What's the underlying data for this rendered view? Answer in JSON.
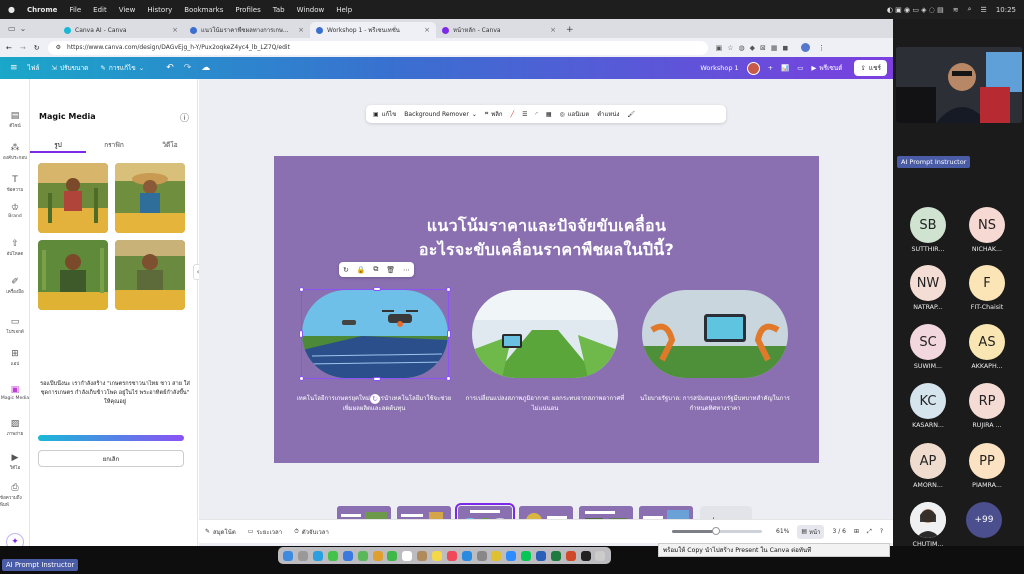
{
  "menubar": {
    "app": "Chrome",
    "items": [
      "File",
      "Edit",
      "View",
      "History",
      "Bookmarks",
      "Profiles",
      "Tab",
      "Window",
      "Help"
    ],
    "clock": "10:25"
  },
  "tabs": [
    {
      "label": "Canva AI - Canva"
    },
    {
      "label": "แนวโน้มราคาพืชผลทางการเกษ..."
    },
    {
      "label": "Workshop 1 - พรีเซนเทชั่น"
    },
    {
      "label": "หน้าหลัก - Canva"
    }
  ],
  "address": {
    "url": "https://www.canva.com/design/DAGvEjg_h-Y/Pux2oqkeZ4yc4_lb_LZ7Q/edit"
  },
  "canva_header": {
    "file": "ไฟล์",
    "resize": "ปรับขนาด",
    "editing": "การแก้ไข",
    "doc_title": "Workshop 1",
    "present": "พรีเซนต์",
    "share": "แชร์"
  },
  "rail": {
    "items": [
      "ดีไซน์",
      "องค์ประกอบ",
      "ข้อความ",
      "Brand",
      "อัปโหลด",
      "เครื่องมือ",
      "โปรเจกต์",
      "แอป",
      "Magic Media",
      "ภาพถ่าย",
      "วิดีโอ",
      "ข้อความถึงพิมพ์"
    ]
  },
  "panel": {
    "title": "Magic Media",
    "tabs": [
      "รูป",
      "กราฟิก",
      "วิดีโอ"
    ],
    "prompt": "รอแป๊บนึงนะ เรากำลังสร้าง \"เกษตรกรชาวนาไทย ชาว สาย ใส่ชุดการเกษตร กำลังเก็บข้าวโพด อยู่ในไร่ พระอาทิตย์กำลังขึ้น\" ให้คุณอยู่",
    "cancel": "ยกเลิก"
  },
  "toolbar": {
    "edit": "แก้ไข",
    "bg_remover": "Background Remover",
    "crop": "พลิก",
    "animate": "แอนิเมต",
    "position": "ตำแหน่ง"
  },
  "slide": {
    "title_line1": "แนวโน้มราคาและปัจจัยขับเคลื่อน",
    "title_line2": "อะไรจะขับเคลื่อนราคาพืชผลในปีนี้?",
    "captions": [
      "เทคโนโลยีการเกษตรยุคใหม่: การนำเทคโนโลยีมาใช้จะช่วยเพิ่มผลผลิตและลดต้นทุน",
      "การเปลี่ยนแปลงสภาพภูมิอากาศ: ผลกระทบจากสภาพอากาศที่ไม่แน่นอน",
      "นโยบายรัฐบาล: การสนับสนุนจากรัฐมีบทบาทสำคัญในการกำหนดทิศทางราคา"
    ]
  },
  "filmstrip": {
    "slides": [
      "1",
      "2",
      "3",
      "4",
      "5",
      "6"
    ]
  },
  "bottom": {
    "notes": "สมุดโน้ต",
    "duration": "ระยะเวลา",
    "timer": "ตัวจับเวลา",
    "zoom": "61%",
    "page_view": "หน้า",
    "page_count": "3 / 6"
  },
  "video": {
    "presenter_label": "AI Prompt Instructor",
    "participants": [
      {
        "initials": "SB",
        "name": "SUTTHIR...",
        "color": "#cfe3d0"
      },
      {
        "initials": "NS",
        "name": "NICHAK...",
        "color": "#f6d9d3"
      },
      {
        "initials": "NW",
        "name": "NATRAP...",
        "color": "#f4ddd4"
      },
      {
        "initials": "F",
        "name": "FIT-Chaisit",
        "color": "#fbe5b6"
      },
      {
        "initials": "SC",
        "name": "SUWIM...",
        "color": "#f2d8de"
      },
      {
        "initials": "AS",
        "name": "AKKAPH...",
        "color": "#f9e6b2"
      },
      {
        "initials": "KC",
        "name": "KASARN...",
        "color": "#d6e4ee"
      },
      {
        "initials": "RP",
        "name": "RUJIRA ...",
        "color": "#f4dcd4"
      },
      {
        "initials": "AP",
        "name": "AMORN...",
        "color": "#f0dccf"
      },
      {
        "initials": "PP",
        "name": "PIAMRA...",
        "color": "#fbe2c2"
      },
      {
        "initials": "",
        "name": "CHUTIM...",
        "color": "#ffffff"
      }
    ],
    "more": "+99"
  },
  "bottom_tag": "AI Prompt Instructor",
  "tooltip": "พร้อมให้ Copy นำไปสร้าง Present ใน Canva ต่อทันที"
}
